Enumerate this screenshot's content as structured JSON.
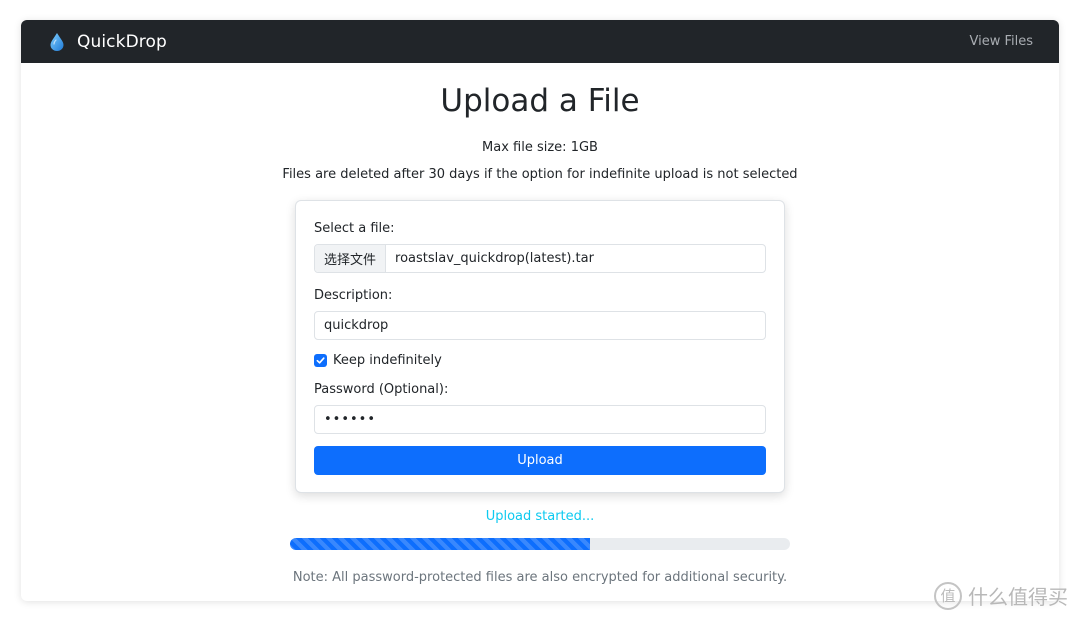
{
  "app": {
    "brand": "QuickDrop",
    "nav_link": "View Files"
  },
  "page": {
    "title": "Upload a File",
    "max_size": "Max file size: 1GB",
    "retention_note": "Files are deleted after 30 days if the option for indefinite upload is not selected"
  },
  "form": {
    "file_label": "Select a file:",
    "file_button": "选择文件",
    "file_name": "roastslav_quickdrop(latest).tar",
    "description_label": "Description:",
    "description_value": "quickdrop",
    "keep_label": "Keep indefinitely",
    "keep_checked": true,
    "password_label": "Password (Optional):",
    "password_mask": "••••••",
    "upload_button": "Upload"
  },
  "status": {
    "text": "Upload started...",
    "progress_fraction": 0.6
  },
  "footer": {
    "note": "Note: All password-protected files are also encrypted for additional security."
  },
  "watermark": {
    "glyph": "值",
    "text": "什么值得买"
  },
  "colors": {
    "navbar": "#212529",
    "primary": "#0d6efd",
    "status": "#0dcaf0",
    "drop_icon": "#3aa0e8"
  },
  "icons": {
    "brand": "water-drop-icon",
    "checkbox": "checkmark-icon"
  }
}
